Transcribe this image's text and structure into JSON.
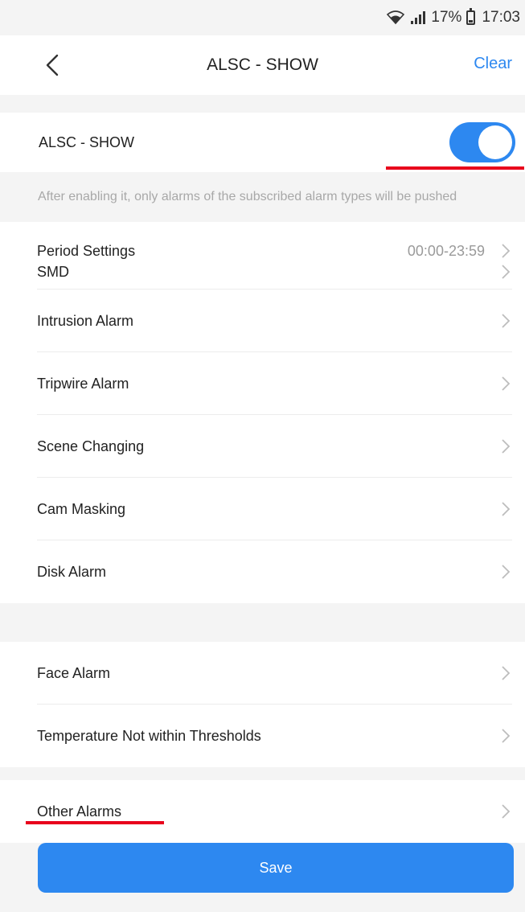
{
  "status_bar": {
    "battery": "17%",
    "time": "17:03"
  },
  "nav": {
    "title": "ALSC - SHOW",
    "clear_label": "Clear"
  },
  "toggle": {
    "label": "ALSC - SHOW",
    "enabled": true
  },
  "hint": "After enabling it, only alarms of the subscribed alarm types will be pushed",
  "period": {
    "label": "Period Settings",
    "value": "00:00-23:59"
  },
  "alarms_group1": [
    {
      "label": "SMD"
    },
    {
      "label": "Intrusion Alarm"
    },
    {
      "label": "Tripwire Alarm"
    },
    {
      "label": "Scene Changing"
    },
    {
      "label": "Cam Masking"
    },
    {
      "label": "Disk Alarm"
    }
  ],
  "alarms_group2": [
    {
      "label": "Face Alarm"
    },
    {
      "label": "Temperature Not within Thresholds"
    }
  ],
  "alarms_group3": [
    {
      "label": "Other Alarms"
    }
  ],
  "save_label": "Save",
  "colors": {
    "accent": "#2d88f0",
    "annotation": "#e8001c"
  }
}
